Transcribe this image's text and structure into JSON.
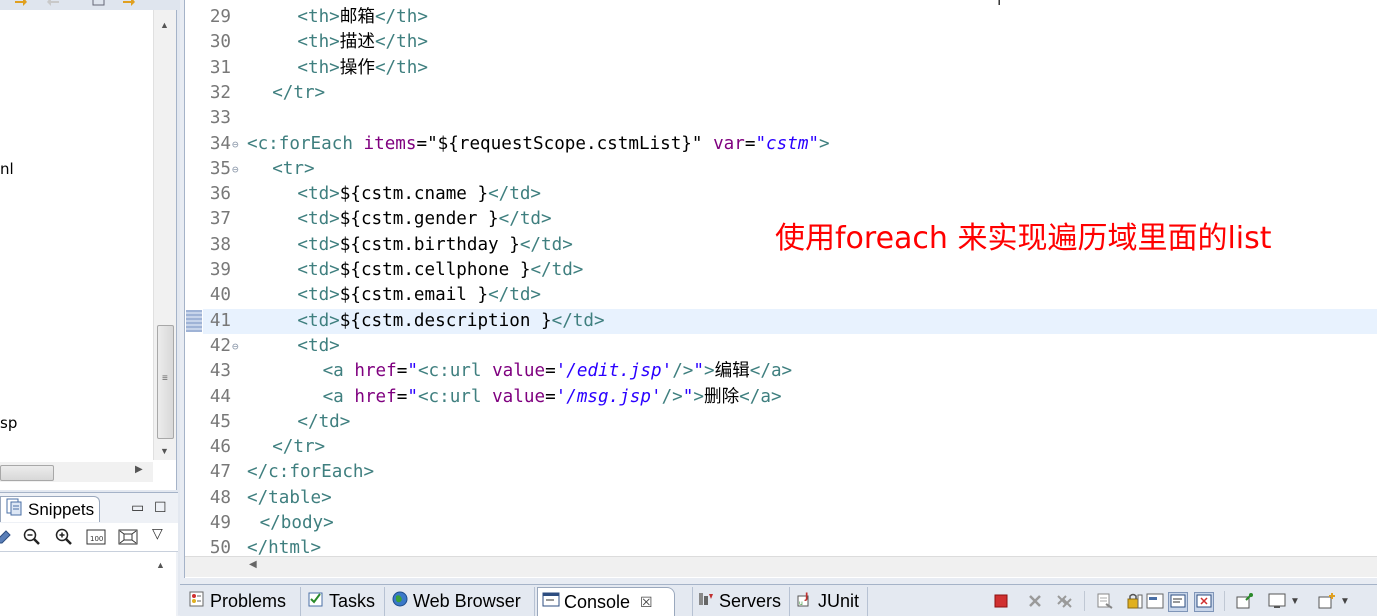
{
  "explorer": {
    "tree_fragments": [
      "nl",
      "sp"
    ]
  },
  "snippets": {
    "tab_label": "Snippets",
    "minimize_label": "▭",
    "maximize_label": "☐",
    "menu_label": "▽"
  },
  "editor": {
    "lines": [
      {
        "n": "29",
        "fold": "",
        "indent": 4,
        "segs": [
          [
            "tag",
            "<th>"
          ],
          [
            "txt",
            "邮箱"
          ],
          [
            "tag",
            "</th>"
          ]
        ]
      },
      {
        "n": "30",
        "fold": "",
        "indent": 4,
        "segs": [
          [
            "tag",
            "<th>"
          ],
          [
            "txt",
            "描述"
          ],
          [
            "tag",
            "</th>"
          ]
        ]
      },
      {
        "n": "31",
        "fold": "",
        "indent": 4,
        "segs": [
          [
            "tag",
            "<th>"
          ],
          [
            "txt",
            "操作"
          ],
          [
            "tag",
            "</th>"
          ]
        ]
      },
      {
        "n": "32",
        "fold": "",
        "indent": 2,
        "segs": [
          [
            "tag",
            "</tr>"
          ]
        ]
      },
      {
        "n": "33",
        "fold": "",
        "indent": 0,
        "segs": []
      },
      {
        "n": "34",
        "fold": "⊖",
        "indent": 0,
        "segs": [
          [
            "tag",
            "<c:forEach "
          ],
          [
            "attr",
            "items"
          ],
          [
            "txt",
            "="
          ],
          [
            "txt",
            "\"${requestScope.cstmList}\" "
          ],
          [
            "attr",
            "var"
          ],
          [
            "txt",
            "="
          ],
          [
            "stri",
            "\"cstm\""
          ],
          [
            "tag",
            ">"
          ]
        ]
      },
      {
        "n": "35",
        "fold": "⊖",
        "indent": 2,
        "segs": [
          [
            "tag",
            "<tr>"
          ]
        ]
      },
      {
        "n": "36",
        "fold": "",
        "indent": 4,
        "segs": [
          [
            "tag",
            "<td>"
          ],
          [
            "txt",
            "${cstm.cname }"
          ],
          [
            "tag",
            "</td>"
          ]
        ]
      },
      {
        "n": "37",
        "fold": "",
        "indent": 4,
        "segs": [
          [
            "tag",
            "<td>"
          ],
          [
            "txt",
            "${cstm.gender }"
          ],
          [
            "tag",
            "</td>"
          ]
        ]
      },
      {
        "n": "38",
        "fold": "",
        "indent": 4,
        "segs": [
          [
            "tag",
            "<td>"
          ],
          [
            "txt",
            "${cstm.birthday }"
          ],
          [
            "tag",
            "</td>"
          ]
        ]
      },
      {
        "n": "39",
        "fold": "",
        "indent": 4,
        "segs": [
          [
            "tag",
            "<td>"
          ],
          [
            "txt",
            "${cstm.cellphone }"
          ],
          [
            "tag",
            "</td>"
          ]
        ]
      },
      {
        "n": "40",
        "fold": "",
        "indent": 4,
        "segs": [
          [
            "tag",
            "<td>"
          ],
          [
            "txt",
            "${cstm.email }"
          ],
          [
            "tag",
            "</td>"
          ]
        ]
      },
      {
        "n": "41",
        "fold": "",
        "indent": 4,
        "current": true,
        "segs": [
          [
            "tag",
            "<td>"
          ],
          [
            "txt",
            "${cstm.description }"
          ],
          [
            "tag",
            "</td>"
          ]
        ]
      },
      {
        "n": "42",
        "fold": "⊖",
        "indent": 4,
        "segs": [
          [
            "tag",
            "<td>"
          ]
        ]
      },
      {
        "n": "43",
        "fold": "",
        "indent": 6,
        "segs": [
          [
            "tag",
            "<a "
          ],
          [
            "attr",
            "href"
          ],
          [
            "txt",
            "="
          ],
          [
            "str",
            "\""
          ],
          [
            "tag",
            "<c:url "
          ],
          [
            "attr",
            "value"
          ],
          [
            "txt",
            "="
          ],
          [
            "stri",
            "'/edit.jsp'"
          ],
          [
            "tag",
            "/>"
          ],
          [
            "str",
            "\""
          ],
          [
            "tag",
            ">"
          ],
          [
            "txt",
            "编辑"
          ],
          [
            "tag",
            "</a>"
          ]
        ]
      },
      {
        "n": "44",
        "fold": "",
        "indent": 6,
        "segs": [
          [
            "tag",
            "<a "
          ],
          [
            "attr",
            "href"
          ],
          [
            "txt",
            "="
          ],
          [
            "str",
            "\""
          ],
          [
            "tag",
            "<c:url "
          ],
          [
            "attr",
            "value"
          ],
          [
            "txt",
            "="
          ],
          [
            "stri",
            "'/msg.jsp'"
          ],
          [
            "tag",
            "/>"
          ],
          [
            "str",
            "\""
          ],
          [
            "tag",
            ">"
          ],
          [
            "txt",
            "删除"
          ],
          [
            "tag",
            "</a>"
          ]
        ]
      },
      {
        "n": "45",
        "fold": "",
        "indent": 4,
        "segs": [
          [
            "tag",
            "</td>"
          ]
        ]
      },
      {
        "n": "46",
        "fold": "",
        "indent": 2,
        "segs": [
          [
            "tag",
            "</tr>"
          ]
        ]
      },
      {
        "n": "47",
        "fold": "",
        "indent": 0,
        "segs": [
          [
            "tag",
            "</c:forEach>"
          ]
        ]
      },
      {
        "n": "48",
        "fold": "",
        "indent": 0,
        "segs": [
          [
            "tag",
            "</table>"
          ]
        ]
      },
      {
        "n": "49",
        "fold": "",
        "indent": 1,
        "segs": [
          [
            "tag",
            "</body>"
          ]
        ]
      },
      {
        "n": "50",
        "fold": "",
        "indent": 0,
        "segs": [
          [
            "tag",
            "</html>"
          ]
        ]
      }
    ],
    "annotation": "使用foreach  来实现遍历域里面的list"
  },
  "bottom_tabs": [
    {
      "label": "Problems",
      "icon": "problems-icon"
    },
    {
      "label": "Tasks",
      "icon": "tasks-icon"
    },
    {
      "label": "Web Browser",
      "icon": "web-browser-icon"
    },
    {
      "label": "Console",
      "icon": "console-icon",
      "active": true,
      "close": "☒"
    },
    {
      "label": "Servers",
      "icon": "servers-icon"
    },
    {
      "label": "JUnit",
      "icon": "junit-icon"
    }
  ],
  "colors": {
    "tag": "#3f7f7f",
    "attribute": "#7f007f",
    "string": "#2a00ff",
    "annotation": "#ff0000",
    "current_line": "#e8f2fe"
  }
}
